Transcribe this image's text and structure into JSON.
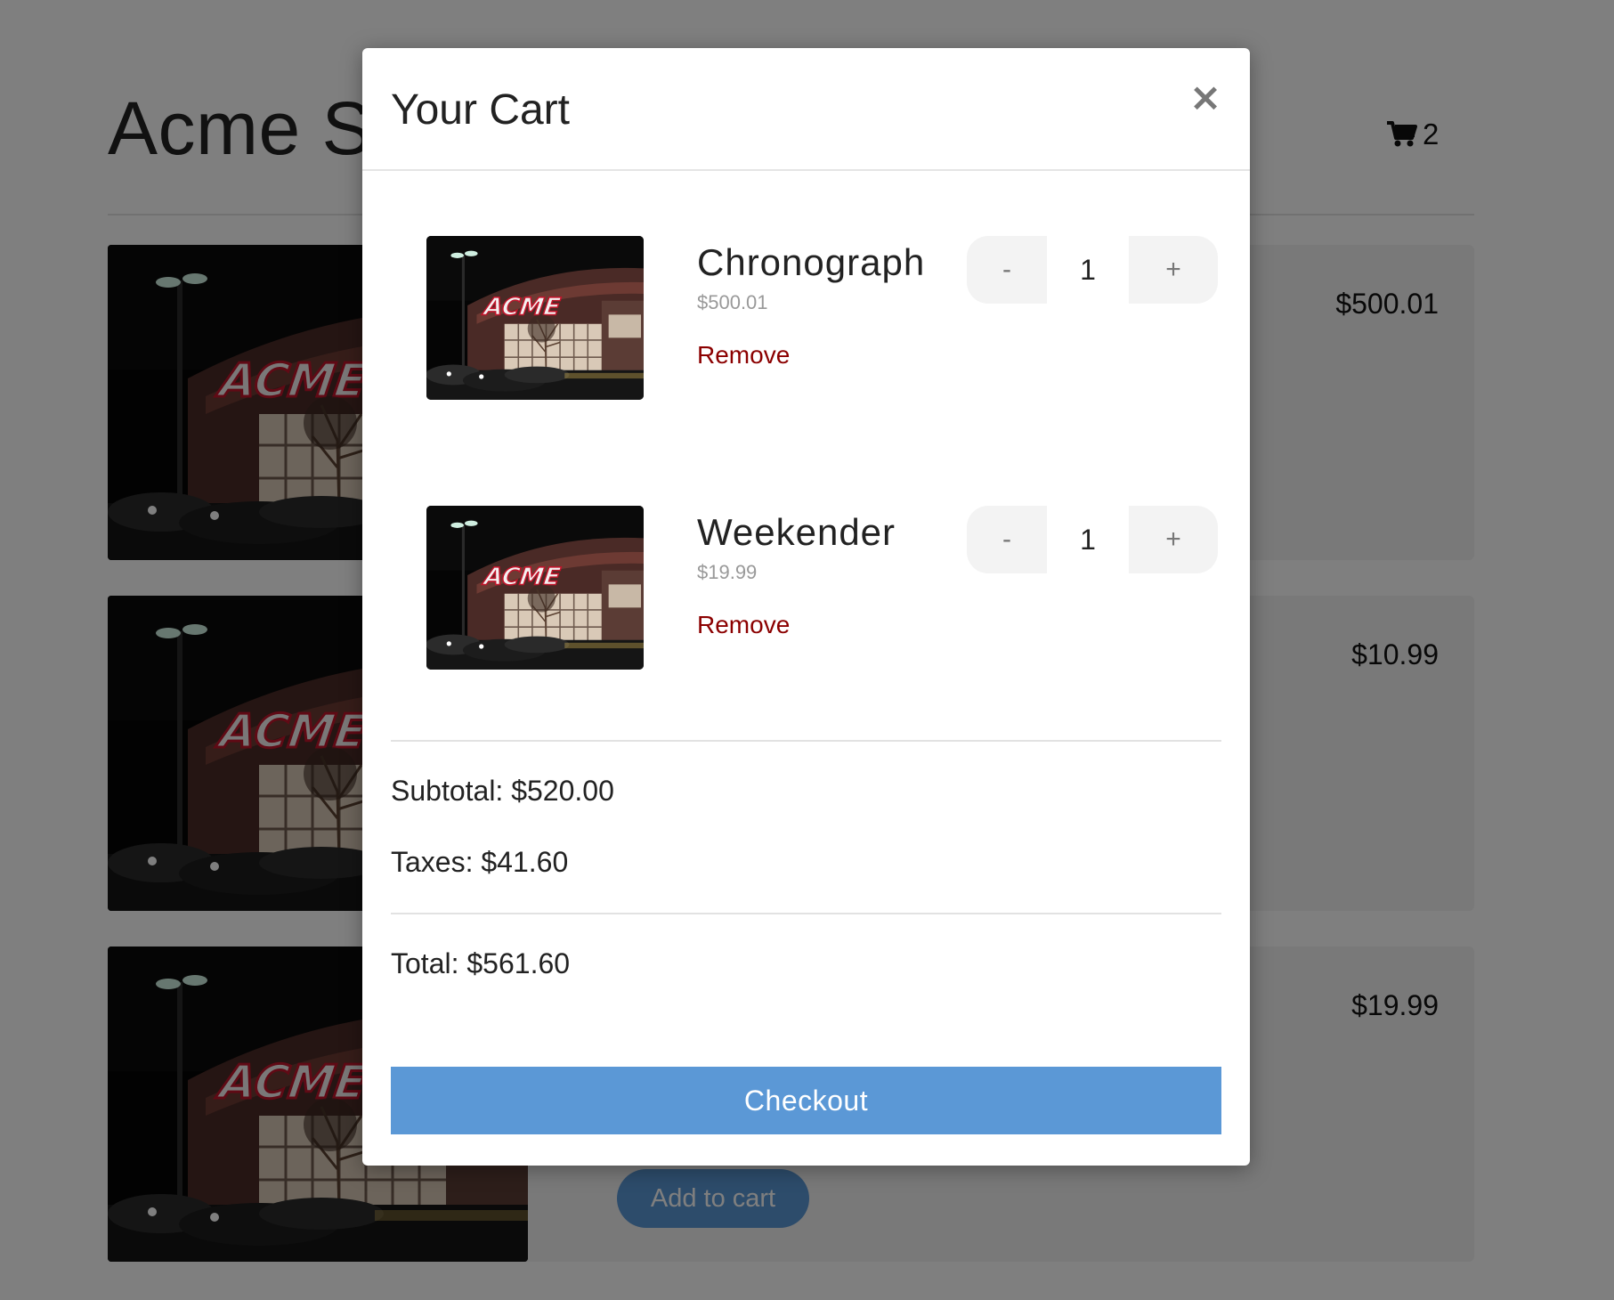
{
  "store": {
    "title": "Acme Store",
    "cart_count": "2",
    "add_to_cart_label": "Add to cart",
    "products": [
      {
        "price": "$500.01"
      },
      {
        "price": "$10.99"
      },
      {
        "price": "$19.99"
      }
    ]
  },
  "modal": {
    "title": "Your Cart",
    "close_label": "×",
    "items": [
      {
        "name": "Chronograph",
        "price": "$500.01",
        "remove_label": "Remove",
        "qty": "1",
        "minus": "-",
        "plus": "+"
      },
      {
        "name": "Weekender",
        "price": "$19.99",
        "remove_label": "Remove",
        "qty": "1",
        "minus": "-",
        "plus": "+"
      }
    ],
    "subtotal": "Subtotal: $520.00",
    "taxes": "Taxes: $41.60",
    "total": "Total: $561.60",
    "checkout_label": "Checkout"
  },
  "icons": {
    "cart": "cart-icon",
    "close": "close-icon"
  },
  "colors": {
    "accent": "#5b98d6",
    "remove": "#8b0000",
    "overlay": "rgba(0,0,0,0.5)"
  }
}
